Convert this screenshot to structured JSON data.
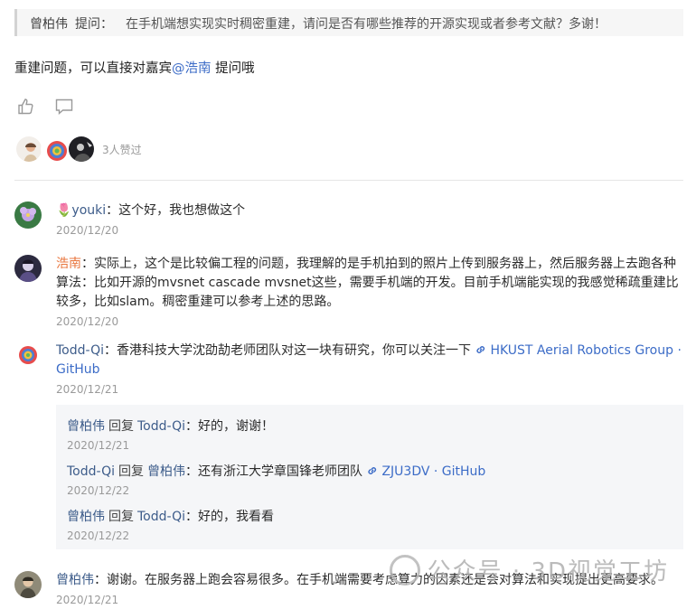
{
  "quote": {
    "author": "曾柏伟",
    "tag": "提问：",
    "text": "在手机端想实现实时稠密重建，请问是否有哪些推荐的开源实现或者参考文献？多谢！"
  },
  "answer": {
    "prefix": "重建问题，可以直接对嘉宾",
    "mention": "@浩南",
    "suffix": " 提问哦"
  },
  "actions": {
    "like_icon": "thumbs-up-icon",
    "comment_icon": "comment-icon"
  },
  "likes": {
    "count_text": "3人赞过"
  },
  "comments": [
    {
      "name": "🌷youki",
      "sep": "：",
      "text": "这个好，我也想做这个",
      "date": "2020/12/20"
    },
    {
      "name": "浩南",
      "sep": "：",
      "text": "实际上，这个是比较偏工程的问题，我理解的是手机拍到的照片上传到服务器上，然后服务器上去跑各种算法：比如开源的mvsnet cascade mvsnet这些，需要手机端的开发。目前手机端能实现的我感觉稀疏重建比较多，比如slam。稠密重建可以参考上述的思路。",
      "date": "2020/12/20"
    },
    {
      "name": "Todd-Qi",
      "sep": "：",
      "text": "香港科技大学沈劭劼老师团队对这一块有研究，你可以关注一下",
      "link": "HKUST Aerial Robotics Group · GitHub",
      "date": "2020/12/21"
    },
    {
      "name": "曾柏伟",
      "sep": "：",
      "text": "谢谢。在服务器上跑会容易很多。在手机端需要考虑算力的因素还是会对算法和实现提出更高要求。",
      "date": "2020/12/21"
    }
  ],
  "replies": [
    {
      "from": "曾柏伟",
      "verb": "回复",
      "to": "Todd-Qi",
      "sep": "：",
      "text": "好的，谢谢！",
      "date": "2020/12/21"
    },
    {
      "from": "Todd-Qi",
      "verb": "回复",
      "to": "曾柏伟",
      "sep": "：",
      "text": "还有浙江大学章国锋老师团队",
      "link": "ZJU3DV · GitHub",
      "date": "2020/12/22"
    },
    {
      "from": "曾柏伟",
      "verb": "回复",
      "to": "Todd-Qi",
      "sep": "：",
      "text": "好的，我看看",
      "date": "2020/12/22"
    }
  ],
  "watermark": {
    "text": "公众号 · 3D视觉工坊"
  },
  "colors": {
    "mention": "#3c6cc7",
    "user_name": "#3d5c8a",
    "highlight_name": "#e9773f",
    "date": "#9a9a9a",
    "reply_bg": "#f5f6f8"
  }
}
